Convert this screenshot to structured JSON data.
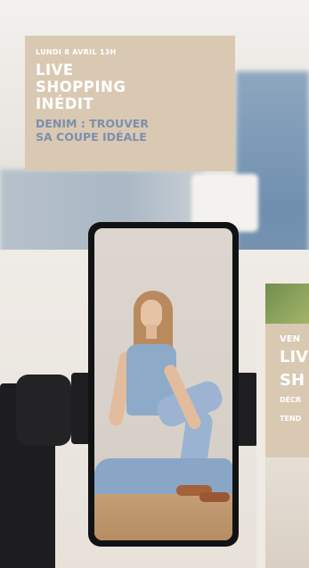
{
  "event_card": {
    "date": "LUNDI 8 AVRIL 13H",
    "title_lines": [
      "LIVE",
      "SHOPPING",
      "INÉDIT"
    ],
    "subtitle_lines": [
      "DENIM : TROUVER",
      "SA COUPE IDÉALE"
    ]
  },
  "next_card": {
    "line1": "VEN",
    "line2": "LIV",
    "line3": "SH",
    "line4": "DÉCR",
    "line5": "TEND"
  },
  "colors": {
    "card_beige": "#d9c9b3",
    "subtitle_blue": "#7c8fad",
    "title_white": "#ffffff"
  }
}
